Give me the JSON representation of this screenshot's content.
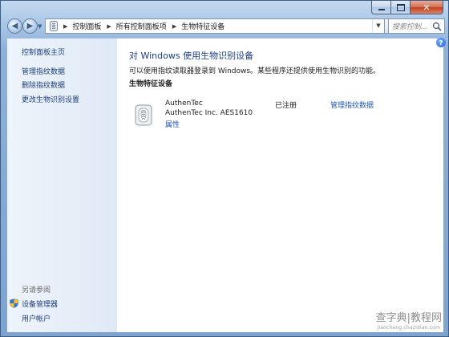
{
  "window": {
    "caption_buttons": [
      "minimize-icon",
      "maximize-icon",
      "close-icon"
    ]
  },
  "nav": {
    "back_icon": "back-arrow-icon",
    "forward_icon": "forward-arrow-icon",
    "breadcrumb": [
      "控制面板",
      "所有控制面板项",
      "生物特征设备"
    ],
    "search_placeholder": "搜索控制...",
    "refresh_icon": "refresh-icon"
  },
  "sidebar": {
    "items": [
      "控制面板主页",
      "管理指纹数据",
      "删除指纹数据",
      "更改生物识别设置"
    ],
    "see_also_title": "另请参阅",
    "see_also": [
      "设备管理器",
      "用户帐户"
    ]
  },
  "main": {
    "title": "对 Windows 使用生物识别设备",
    "description": "可以使用指纹读取器登录到 Windows。某些程序还提供使用生物识别的功能。",
    "section_title": "生物特征设备",
    "device": {
      "name": "AuthenTec",
      "model": "AuthenTec Inc. AES1610",
      "properties_link": "属性",
      "status": "已注册",
      "manage_link": "管理指纹数据",
      "icon": "fingerprint-reader-icon"
    }
  },
  "watermark": {
    "text": "查字典|教程网",
    "sub": "jiaocheng.chazidian.com"
  },
  "colors": {
    "link": "#1e57b8",
    "title": "#1d3e87",
    "sidebar_link": "#1e3f7a"
  }
}
